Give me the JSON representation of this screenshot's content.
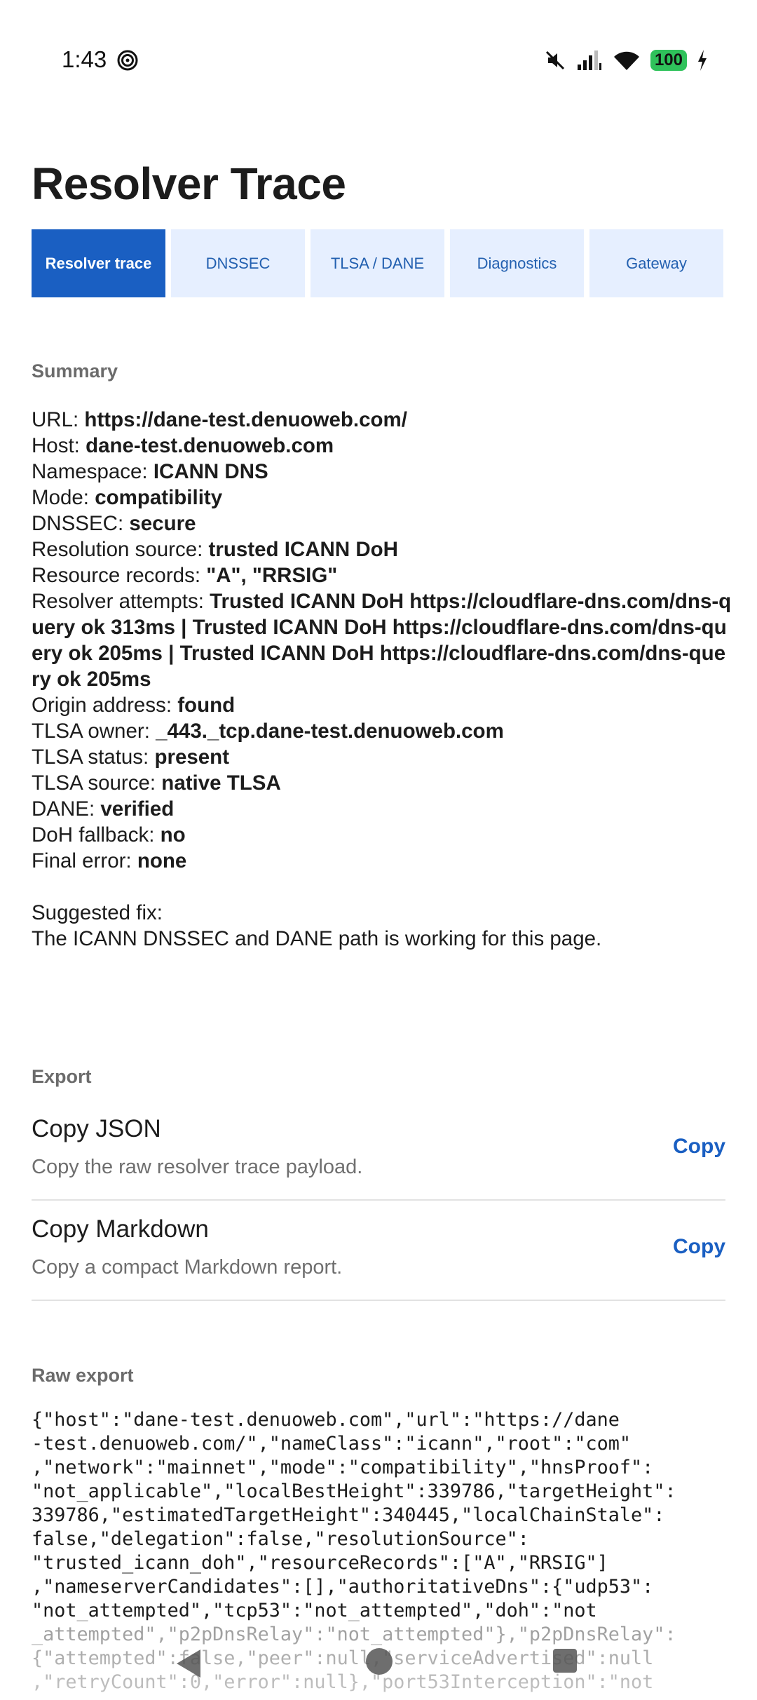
{
  "status_bar": {
    "time": "1:43",
    "battery": "100"
  },
  "page": {
    "title": "Resolver Trace"
  },
  "tabs": [
    {
      "label": "Resolver trace",
      "active": true
    },
    {
      "label": "DNSSEC",
      "active": false
    },
    {
      "label": "TLSA / DANE",
      "active": false
    },
    {
      "label": "Diagnostics",
      "active": false
    },
    {
      "label": "Gateway",
      "active": false
    }
  ],
  "summary": {
    "heading": "Summary",
    "rows": [
      {
        "label": "URL: ",
        "value": "https://dane-test.denuoweb.com/"
      },
      {
        "label": "Host: ",
        "value": "dane-test.denuoweb.com"
      },
      {
        "label": "Namespace: ",
        "value": "ICANN DNS"
      },
      {
        "label": "Mode: ",
        "value": "compatibility"
      },
      {
        "label": "DNSSEC: ",
        "value": "secure"
      },
      {
        "label": "Resolution source: ",
        "value": "trusted ICANN DoH"
      },
      {
        "label": "Resource records: ",
        "value": "\"A\", \"RRSIG\""
      },
      {
        "label": "Resolver attempts: ",
        "value": "Trusted ICANN DoH https://cloudflare-dns.com/dns-query ok 313ms | Trusted ICANN DoH https://cloudflare-dns.com/dns-query ok 205ms | Trusted ICANN DoH https://cloudflare-dns.com/dns-query ok 205ms"
      },
      {
        "label": "Origin address: ",
        "value": "found"
      },
      {
        "label": "TLSA owner: ",
        "value": "_443._tcp.dane-test.denuoweb.com"
      },
      {
        "label": "TLSA status: ",
        "value": "present"
      },
      {
        "label": "TLSA source: ",
        "value": "native TLSA"
      },
      {
        "label": "DANE: ",
        "value": "verified"
      },
      {
        "label": "DoH fallback: ",
        "value": "no"
      },
      {
        "label": "Final error: ",
        "value": "none"
      }
    ],
    "fix_label": "Suggested fix:",
    "fix_text": "The ICANN DNSSEC and DANE path is working for this page."
  },
  "export": {
    "heading": "Export",
    "items": [
      {
        "title": "Copy JSON",
        "subtitle": "Copy the raw resolver trace payload.",
        "action": "Copy"
      },
      {
        "title": "Copy Markdown",
        "subtitle": "Copy a compact Markdown report.",
        "action": "Copy"
      }
    ]
  },
  "raw_export": {
    "heading": "Raw export",
    "text": "{\"host\":\"dane-test.denuoweb.com\",\"url\":\"https://dane\n-test.denuoweb.com/\",\"nameClass\":\"icann\",\"root\":\"com\"\n,\"network\":\"mainnet\",\"mode\":\"compatibility\",\"hnsProof\":\n\"not_applicable\",\"localBestHeight\":339786,\"targetHeight\":\n339786,\"estimatedTargetHeight\":340445,\"localChainStale\":\nfalse,\"delegation\":false,\"resolutionSource\":\n\"trusted_icann_doh\",\"resourceRecords\":[\"A\",\"RRSIG\"]\n,\"nameserverCandidates\":[],\"authoritativeDns\":{\"udp53\":\n\"not_attempted\",\"tcp53\":\"not_attempted\",\"doh\":\"not\n_attempted\",\"p2pDnsRelay\":\"not_attempted\"},\"p2pDnsRelay\":\n{\"attempted\":false,\"peer\":null,\"serviceAdvertised\":null\n,\"retryCount\":0,\"error\":null},\"port53Interception\":\"not"
  }
}
